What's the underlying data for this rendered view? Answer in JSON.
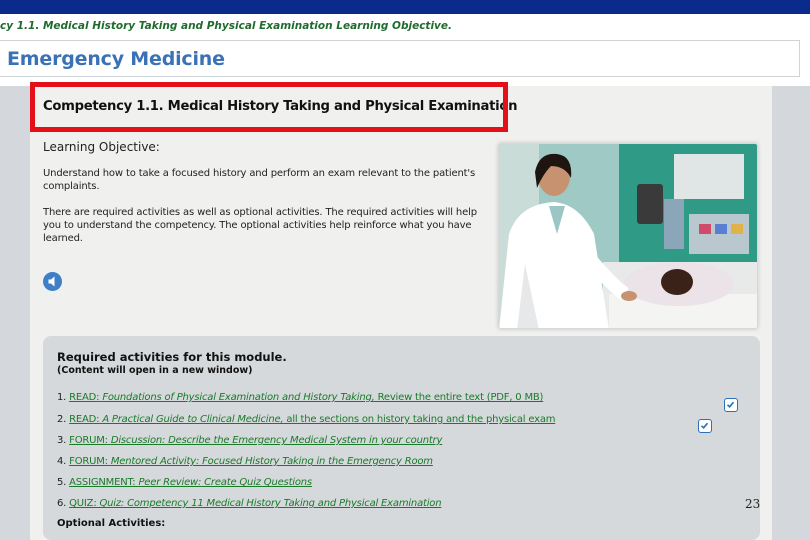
{
  "breadcrumb": "cy 1.1. Medical History Taking and Physical Examination Learning Objective.",
  "site_title": "Emergency Medicine",
  "competency_title": "Competency 1.1. Medical History Taking and Physical Examination",
  "learning_objective": {
    "heading": "Learning Objective:",
    "paragraph1": "Understand how to take a focused history and perform an exam relevant to the patient's complaints.",
    "paragraph2": "There are required activities as well as optional activities. The required activities will help you to understand the competency. The optional activities help reinforce what you have learned."
  },
  "required": {
    "heading": "Required activities for this module.",
    "subheading": "(Content will open in a new window)",
    "items": [
      {
        "num": "1.",
        "type": "READ:",
        "title": "Foundations of Physical Examination and History Taking,",
        "rest": " Review the entire text (PDF, 0 MB)"
      },
      {
        "num": "2.",
        "type": "READ:",
        "title": "A Practical Guide to Clinical Medicine,",
        "rest": " all the sections on history taking and the physical exam"
      },
      {
        "num": "3.",
        "type": "FORUM:",
        "title": "Discussion: Describe the Emergency Medical System in your country",
        "rest": ""
      },
      {
        "num": "4.",
        "type": "FORUM:",
        "title": "Mentored Activity: Focused History Taking in the Emergency Room",
        "rest": ""
      },
      {
        "num": "5.",
        "type": "ASSIGNMENT:",
        "title": "Peer Review: Create Quiz Questions",
        "rest": ""
      },
      {
        "num": "6.",
        "type": "QUIZ:",
        "title": "Quiz: Competency 11 Medical History Taking and Physical Examination",
        "rest": ""
      }
    ]
  },
  "optional_heading": "Optional Activities:",
  "page_number": "23",
  "colors": {
    "top_bar": "#0a2a8c",
    "title_blue": "#3a72b5",
    "link_green": "#1a7a2a",
    "highlight_red": "#e3101a"
  }
}
